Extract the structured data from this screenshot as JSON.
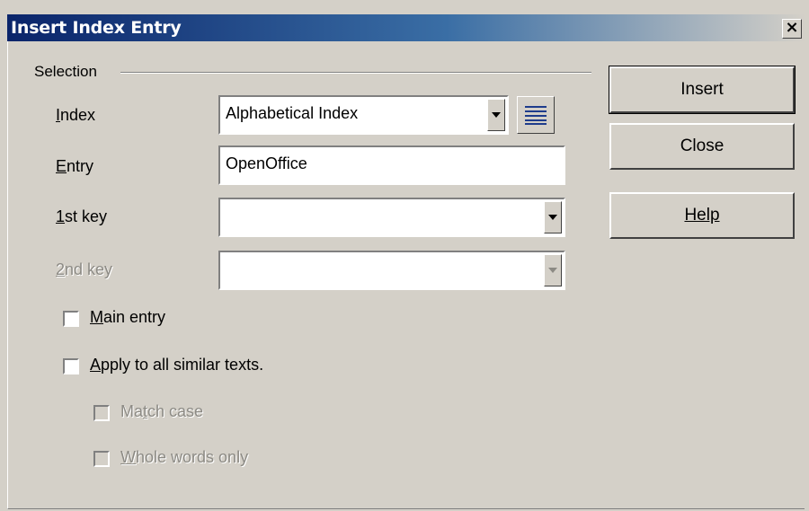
{
  "window": {
    "title": "Insert Index Entry",
    "close_label": "×"
  },
  "selection": {
    "group_label": "Selection",
    "index": {
      "label": "Index",
      "value": "Alphabetical Index"
    },
    "entry": {
      "label": "Entry",
      "value": "OpenOffice"
    },
    "key1": {
      "label": "1st key",
      "value": ""
    },
    "key2": {
      "label": "2nd key",
      "value": "",
      "disabled": true
    },
    "main_entry": {
      "label": "Main entry",
      "checked": false
    },
    "apply_all": {
      "label": "Apply to all similar texts.",
      "checked": false
    },
    "match_case": {
      "label": "Match case",
      "checked": false,
      "disabled": true
    },
    "whole_words": {
      "label": "Whole words only",
      "checked": false,
      "disabled": true
    }
  },
  "buttons": {
    "insert": "Insert",
    "close": "Close",
    "help": "Help"
  },
  "icons": {
    "index_list": "list-icon"
  },
  "colors": {
    "title_start": "#0a246a",
    "title_end": "#3a6ea5",
    "face": "#d4d0c8"
  }
}
